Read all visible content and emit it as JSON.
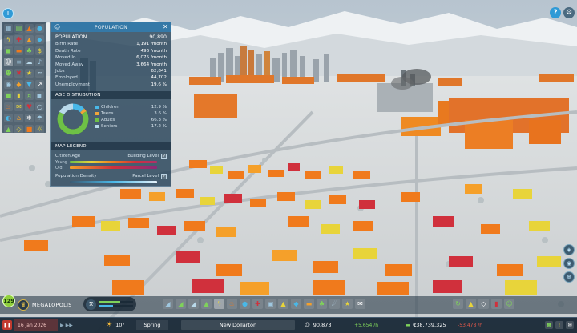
{
  "panel": {
    "title": "POPULATION",
    "stats": [
      {
        "label": "POPULATION",
        "value": "90,890"
      },
      {
        "label": "Birth Rate",
        "value": "1,191 /month"
      },
      {
        "label": "Death Rate",
        "value": "496 /month"
      },
      {
        "label": "Moved In",
        "value": "6,075 /month"
      },
      {
        "label": "Moved Away",
        "value": "3,664 /month"
      },
      {
        "label": "Jobs",
        "value": "62,841"
      },
      {
        "label": "Employed",
        "value": "44,702"
      },
      {
        "label": "Unemployment",
        "value": "19.6 %"
      }
    ],
    "age_distribution": {
      "title": "AGE DISTRIBUTION",
      "groups": [
        {
          "label": "Children",
          "value": "12.9 %",
          "fraction": 0.129,
          "color": "#49b8e8"
        },
        {
          "label": "Teens",
          "value": "3.6 %",
          "fraction": 0.036,
          "color": "#f0a53a"
        },
        {
          "label": "Adults",
          "value": "66.3 %",
          "fraction": 0.663,
          "color": "#6ec046"
        },
        {
          "label": "Seniors",
          "value": "17.2 %",
          "fraction": 0.172,
          "color": "#b9d9ea"
        }
      ]
    },
    "map_legend": {
      "title": "MAP LEGEND",
      "citizen_age": {
        "label": "Citizen Age",
        "toggle_label": "Building Level",
        "toggle_on": true,
        "young_label": "Young",
        "old_label": "Old"
      },
      "population_density": {
        "label": "Population Density",
        "toggle_label": "Parcel Level",
        "toggle_on": true
      }
    }
  },
  "milestone": {
    "level": "129",
    "name": "MEGALOPOLIS"
  },
  "xp": {
    "fill_1": 0.62,
    "fill_2": 0.41
  },
  "status_bar": {
    "date": "16 Jan 2026",
    "temperature": "10°",
    "season": "Spring",
    "city_name": "New Dollarton",
    "population": "90,873",
    "population_change": "+5,654 /h",
    "money": "₡38,739,325",
    "money_change": "-53,478 /h"
  },
  "icons": {
    "top_left": "info-icon",
    "top_right": [
      "help-icon",
      "settings-icon"
    ],
    "trophy": "trophy-icon",
    "xp": "bulldoze-icon",
    "weather": "sun-icon"
  },
  "colors": {
    "panel_bg": "#264258",
    "panel_header": "#347aaa",
    "accent": "#2f9ad6",
    "milestone_green": "#8fcf3c",
    "positive": "#7fd25a",
    "negative": "#e0584a",
    "house_orange": "#f07a1c",
    "house_yellow": "#e8d43a",
    "house_red": "#d0303c"
  }
}
